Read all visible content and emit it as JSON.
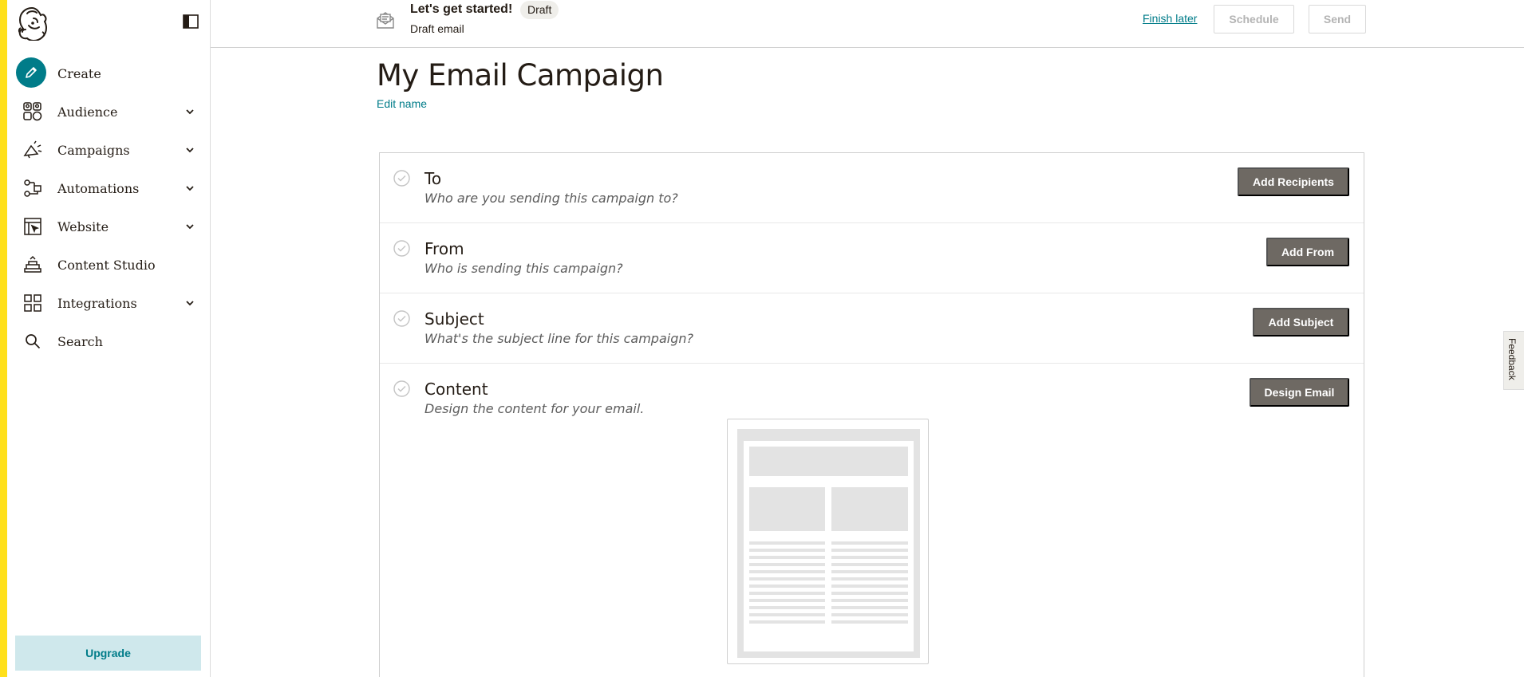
{
  "sidebar": {
    "items": [
      {
        "label": "Create",
        "icon": "pencil-icon",
        "has_chevron": false
      },
      {
        "label": "Audience",
        "icon": "audience-icon",
        "has_chevron": true
      },
      {
        "label": "Campaigns",
        "icon": "megaphone-icon",
        "has_chevron": true
      },
      {
        "label": "Automations",
        "icon": "automation-icon",
        "has_chevron": true
      },
      {
        "label": "Website",
        "icon": "website-icon",
        "has_chevron": true
      },
      {
        "label": "Content Studio",
        "icon": "content-studio-icon",
        "has_chevron": false
      },
      {
        "label": "Integrations",
        "icon": "grid-icon",
        "has_chevron": true
      },
      {
        "label": "Search",
        "icon": "search-icon",
        "has_chevron": false
      }
    ],
    "upgrade_label": "Upgrade"
  },
  "topbar": {
    "title": "Let's get started!",
    "badge": "Draft",
    "subtitle": "Draft email",
    "finish_later": "Finish later",
    "schedule": "Schedule",
    "send": "Send"
  },
  "main": {
    "title": "My Email Campaign",
    "edit_name": "Edit name",
    "rows": [
      {
        "title": "To",
        "description": "Who are you sending this campaign to?",
        "button": "Add Recipients"
      },
      {
        "title": "From",
        "description": "Who is sending this campaign?",
        "button": "Add From"
      },
      {
        "title": "Subject",
        "description": "What's the subject line for this campaign?",
        "button": "Add Subject"
      },
      {
        "title": "Content",
        "description": "Design the content for your email.",
        "button": "Design Email"
      }
    ]
  },
  "feedback_label": "Feedback",
  "colors": {
    "accent": "#007c89",
    "stripe": "#ffe01b",
    "button_dark": "#6e6963",
    "upgrade_bg": "#cfe8ec"
  }
}
